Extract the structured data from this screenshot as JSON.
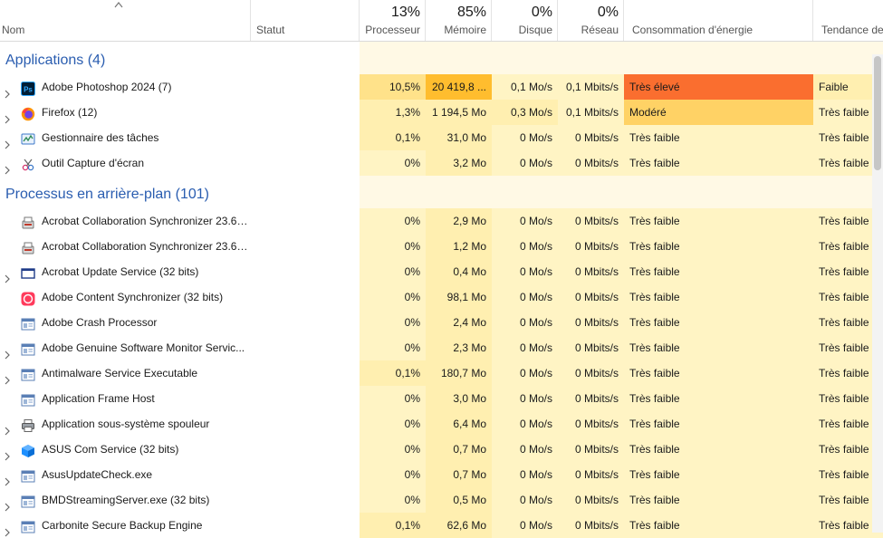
{
  "header": {
    "columns": [
      {
        "key": "name",
        "label": "Nom",
        "pct": ""
      },
      {
        "key": "status",
        "label": "Statut",
        "pct": ""
      },
      {
        "key": "cpu",
        "label": "Processeur",
        "pct": "13%"
      },
      {
        "key": "mem",
        "label": "Mémoire",
        "pct": "85%"
      },
      {
        "key": "disk",
        "label": "Disque",
        "pct": "0%"
      },
      {
        "key": "net",
        "label": "Réseau",
        "pct": "0%"
      },
      {
        "key": "power",
        "label": "Consommation d'énergie",
        "pct": ""
      },
      {
        "key": "trend",
        "label": "Tendance de",
        "pct": ""
      }
    ]
  },
  "groups": [
    {
      "title": "Applications (4)",
      "rows": [
        {
          "expand": true,
          "icon": "photoshop-icon",
          "name": "Adobe Photoshop 2024 (7)",
          "cpu": "10,5%",
          "mem": "20 419,8 ...",
          "disk": "0,1 Mo/s",
          "net": "0,1 Mbits/s",
          "power": "Très élevé",
          "trend": "Faible",
          "heat": {
            "cpu": 2,
            "mem": 4,
            "disk": 0,
            "net": 0,
            "power": 5,
            "trend": 1
          }
        },
        {
          "expand": true,
          "icon": "firefox-icon",
          "name": "Firefox (12)",
          "cpu": "1,3%",
          "mem": "1 194,5 Mo",
          "disk": "0,3 Mo/s",
          "net": "0,1 Mbits/s",
          "power": "Modéré",
          "trend": "Très faible",
          "heat": {
            "cpu": 1,
            "mem": 1,
            "disk": 1,
            "net": 0,
            "power": 3,
            "trend": 0
          }
        },
        {
          "expand": true,
          "icon": "task-manager-icon",
          "name": "Gestionnaire des tâches",
          "cpu": "0,1%",
          "mem": "31,0 Mo",
          "disk": "0 Mo/s",
          "net": "0 Mbits/s",
          "power": "Très faible",
          "trend": "Très faible",
          "heat": {
            "cpu": 1,
            "mem": 1,
            "disk": 0,
            "net": 0,
            "power": 0,
            "trend": 0
          }
        },
        {
          "expand": true,
          "icon": "snipping-tool-icon",
          "name": "Outil Capture d'écran",
          "cpu": "0%",
          "mem": "3,2 Mo",
          "disk": "0 Mo/s",
          "net": "0 Mbits/s",
          "power": "Très faible",
          "trend": "Très faible",
          "heat": {
            "cpu": 0,
            "mem": 1,
            "disk": 0,
            "net": 0,
            "power": 0,
            "trend": 0
          }
        }
      ]
    },
    {
      "title": "Processus en arrière-plan (101)",
      "rows": [
        {
          "expand": false,
          "icon": "acrobat-sync-icon",
          "name": "Acrobat Collaboration Synchronizer 23.6 ...",
          "cpu": "0%",
          "mem": "2,9 Mo",
          "disk": "0 Mo/s",
          "net": "0 Mbits/s",
          "power": "Très faible",
          "trend": "Très faible",
          "heat": {
            "cpu": 0,
            "mem": 1,
            "disk": 0,
            "net": 0,
            "power": 0,
            "trend": 0
          }
        },
        {
          "expand": false,
          "icon": "acrobat-sync-icon",
          "name": "Acrobat Collaboration Synchronizer 23.6 ...",
          "cpu": "0%",
          "mem": "1,2 Mo",
          "disk": "0 Mo/s",
          "net": "0 Mbits/s",
          "power": "Très faible",
          "trend": "Très faible",
          "heat": {
            "cpu": 0,
            "mem": 1,
            "disk": 0,
            "net": 0,
            "power": 0,
            "trend": 0
          }
        },
        {
          "expand": true,
          "icon": "window-icon",
          "name": "Acrobat Update Service (32 bits)",
          "cpu": "0%",
          "mem": "0,4 Mo",
          "disk": "0 Mo/s",
          "net": "0 Mbits/s",
          "power": "Très faible",
          "trend": "Très faible",
          "heat": {
            "cpu": 0,
            "mem": 1,
            "disk": 0,
            "net": 0,
            "power": 0,
            "trend": 0
          }
        },
        {
          "expand": false,
          "icon": "creative-cloud-icon",
          "name": "Adobe Content Synchronizer (32 bits)",
          "cpu": "0%",
          "mem": "98,1 Mo",
          "disk": "0 Mo/s",
          "net": "0 Mbits/s",
          "power": "Très faible",
          "trend": "Très faible",
          "heat": {
            "cpu": 0,
            "mem": 1,
            "disk": 0,
            "net": 0,
            "power": 0,
            "trend": 0
          }
        },
        {
          "expand": false,
          "icon": "service-icon",
          "name": "Adobe Crash Processor",
          "cpu": "0%",
          "mem": "2,4 Mo",
          "disk": "0 Mo/s",
          "net": "0 Mbits/s",
          "power": "Très faible",
          "trend": "Très faible",
          "heat": {
            "cpu": 0,
            "mem": 1,
            "disk": 0,
            "net": 0,
            "power": 0,
            "trend": 0
          }
        },
        {
          "expand": true,
          "icon": "service-icon",
          "name": "Adobe Genuine Software Monitor Servic...",
          "cpu": "0%",
          "mem": "2,3 Mo",
          "disk": "0 Mo/s",
          "net": "0 Mbits/s",
          "power": "Très faible",
          "trend": "Très faible",
          "heat": {
            "cpu": 0,
            "mem": 1,
            "disk": 0,
            "net": 0,
            "power": 0,
            "trend": 0
          }
        },
        {
          "expand": true,
          "icon": "service-icon",
          "name": "Antimalware Service Executable",
          "cpu": "0,1%",
          "mem": "180,7 Mo",
          "disk": "0 Mo/s",
          "net": "0 Mbits/s",
          "power": "Très faible",
          "trend": "Très faible",
          "heat": {
            "cpu": 1,
            "mem": 1,
            "disk": 0,
            "net": 0,
            "power": 0,
            "trend": 0
          }
        },
        {
          "expand": false,
          "icon": "service-icon",
          "name": "Application Frame Host",
          "cpu": "0%",
          "mem": "3,0 Mo",
          "disk": "0 Mo/s",
          "net": "0 Mbits/s",
          "power": "Très faible",
          "trend": "Très faible",
          "heat": {
            "cpu": 0,
            "mem": 1,
            "disk": 0,
            "net": 0,
            "power": 0,
            "trend": 0
          }
        },
        {
          "expand": true,
          "icon": "printer-icon",
          "name": "Application sous-système spouleur",
          "cpu": "0%",
          "mem": "6,4 Mo",
          "disk": "0 Mo/s",
          "net": "0 Mbits/s",
          "power": "Très faible",
          "trend": "Très faible",
          "heat": {
            "cpu": 0,
            "mem": 1,
            "disk": 0,
            "net": 0,
            "power": 0,
            "trend": 0
          }
        },
        {
          "expand": true,
          "icon": "asus-cube-icon",
          "name": "ASUS Com Service (32 bits)",
          "cpu": "0%",
          "mem": "0,7 Mo",
          "disk": "0 Mo/s",
          "net": "0 Mbits/s",
          "power": "Très faible",
          "trend": "Très faible",
          "heat": {
            "cpu": 0,
            "mem": 1,
            "disk": 0,
            "net": 0,
            "power": 0,
            "trend": 0
          }
        },
        {
          "expand": true,
          "icon": "service-icon",
          "name": "AsusUpdateCheck.exe",
          "cpu": "0%",
          "mem": "0,7 Mo",
          "disk": "0 Mo/s",
          "net": "0 Mbits/s",
          "power": "Très faible",
          "trend": "Très faible",
          "heat": {
            "cpu": 0,
            "mem": 1,
            "disk": 0,
            "net": 0,
            "power": 0,
            "trend": 0
          }
        },
        {
          "expand": true,
          "icon": "service-icon",
          "name": "BMDStreamingServer.exe (32 bits)",
          "cpu": "0%",
          "mem": "0,5 Mo",
          "disk": "0 Mo/s",
          "net": "0 Mbits/s",
          "power": "Très faible",
          "trend": "Très faible",
          "heat": {
            "cpu": 0,
            "mem": 1,
            "disk": 0,
            "net": 0,
            "power": 0,
            "trend": 0
          }
        },
        {
          "expand": true,
          "icon": "service-icon",
          "name": "Carbonite Secure Backup Engine",
          "cpu": "0,1%",
          "mem": "62,6 Mo",
          "disk": "0 Mo/s",
          "net": "0 Mbits/s",
          "power": "Très faible",
          "trend": "Très faible",
          "heat": {
            "cpu": 1,
            "mem": 1,
            "disk": 0,
            "net": 0,
            "power": 0,
            "trend": 0
          }
        }
      ]
    }
  ],
  "colors": {
    "heat0": "#fff4c4",
    "heat1": "#ffefb0",
    "heat2": "#ffe28a",
    "heat3": "#ffd265",
    "heat4": "#ffbd2e",
    "heat5": "#fa6e2f",
    "group_band": "#fff9e5",
    "group_title": "#2a5db0"
  }
}
